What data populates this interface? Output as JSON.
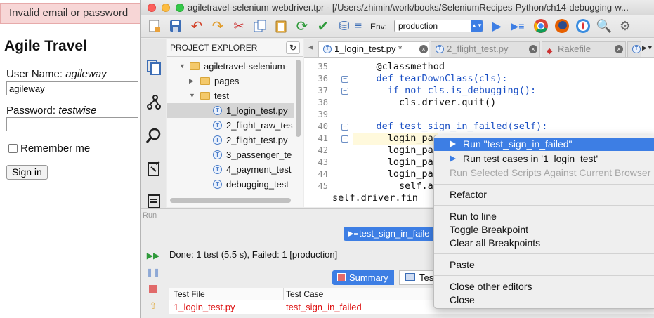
{
  "browser": {
    "flash": "Invalid email or password",
    "heading": "Agile Travel",
    "username_label": "User Name:",
    "username_hint": "agileway",
    "username_value": "agileway",
    "password_label": "Password:",
    "password_hint": "testwise",
    "password_value": "",
    "remember_label": "Remember me",
    "signin_label": "Sign in"
  },
  "window": {
    "title": "agiletravel-selenium-webdriver.tpr - [/Users/zhimin/work/books/SeleniumRecipes-Python/ch14-debugging-w..."
  },
  "toolbar": {
    "env_label": "Env:",
    "env_value": "production"
  },
  "project": {
    "header": "PROJECT EXPLORER",
    "items": [
      {
        "label": "agiletravel-selenium-",
        "kind": "folder"
      },
      {
        "label": "pages",
        "kind": "folder"
      },
      {
        "label": "test",
        "kind": "folder"
      },
      {
        "label": "1_login_test.py",
        "kind": "test"
      },
      {
        "label": "2_flight_raw_tes",
        "kind": "test"
      },
      {
        "label": "2_flight_test.py",
        "kind": "test"
      },
      {
        "label": "3_passenger_te",
        "kind": "test"
      },
      {
        "label": "4_payment_test",
        "kind": "test"
      },
      {
        "label": "debugging_test",
        "kind": "test"
      }
    ]
  },
  "editor": {
    "tabs": [
      {
        "label": "1_login_test.py *"
      },
      {
        "label": "2_flight_test.py"
      },
      {
        "label": "Rakefile"
      }
    ],
    "lines": [
      {
        "no": "35",
        "text": "    @classmethod"
      },
      {
        "no": "36",
        "text": "    def tearDownClass(cls):"
      },
      {
        "no": "37",
        "text": "      if not cls.is_debugging():"
      },
      {
        "no": "38",
        "text": "        cls.driver.quit()"
      },
      {
        "no": "39",
        "text": ""
      },
      {
        "no": "40",
        "text": "    def test_sign_in_failed(self):"
      },
      {
        "no": "41",
        "text": "      login_page"
      },
      {
        "no": "42",
        "text": "      login_page."
      },
      {
        "no": "43",
        "text": "      login_page."
      },
      {
        "no": "44",
        "text": "      login_page."
      },
      {
        "no": "45",
        "text": "        self.assert"
      },
      {
        "no": "",
        "text": "self.driver.fin"
      }
    ]
  },
  "run": {
    "label": "Run",
    "current": "test_sign_in_faile",
    "status": "Done: 1 test (5.5 s), Failed: 1 [production]",
    "summary_tab": "Summary",
    "test_tab": "Test",
    "columns": [
      "Test File",
      "Test Case"
    ],
    "rows": [
      {
        "file": "1_login_test.py",
        "case": "test_sign_in_failed"
      }
    ]
  },
  "context_menu": {
    "items": [
      {
        "label": "Run \"test_sign_in_failed\"",
        "state": "highlighted"
      },
      {
        "label": "Run test cases in '1_login_test'",
        "state": "normal"
      },
      {
        "label": "Run Selected Scripts Against Current Browser",
        "state": "disabled"
      },
      {
        "label": "Refactor",
        "state": "normal"
      },
      {
        "label": "Run to line",
        "state": "normal"
      },
      {
        "label": "Toggle Breakpoint",
        "state": "normal"
      },
      {
        "label": "Clear all Breakpoints",
        "state": "normal"
      },
      {
        "label": "Paste",
        "state": "normal"
      },
      {
        "label": "Close other editors",
        "state": "normal"
      },
      {
        "label": "Close",
        "state": "normal"
      }
    ]
  },
  "colors": {
    "accent": "#3d7ee4",
    "error_text": "#dd1111",
    "flash_bg": "#f7d6d6"
  }
}
